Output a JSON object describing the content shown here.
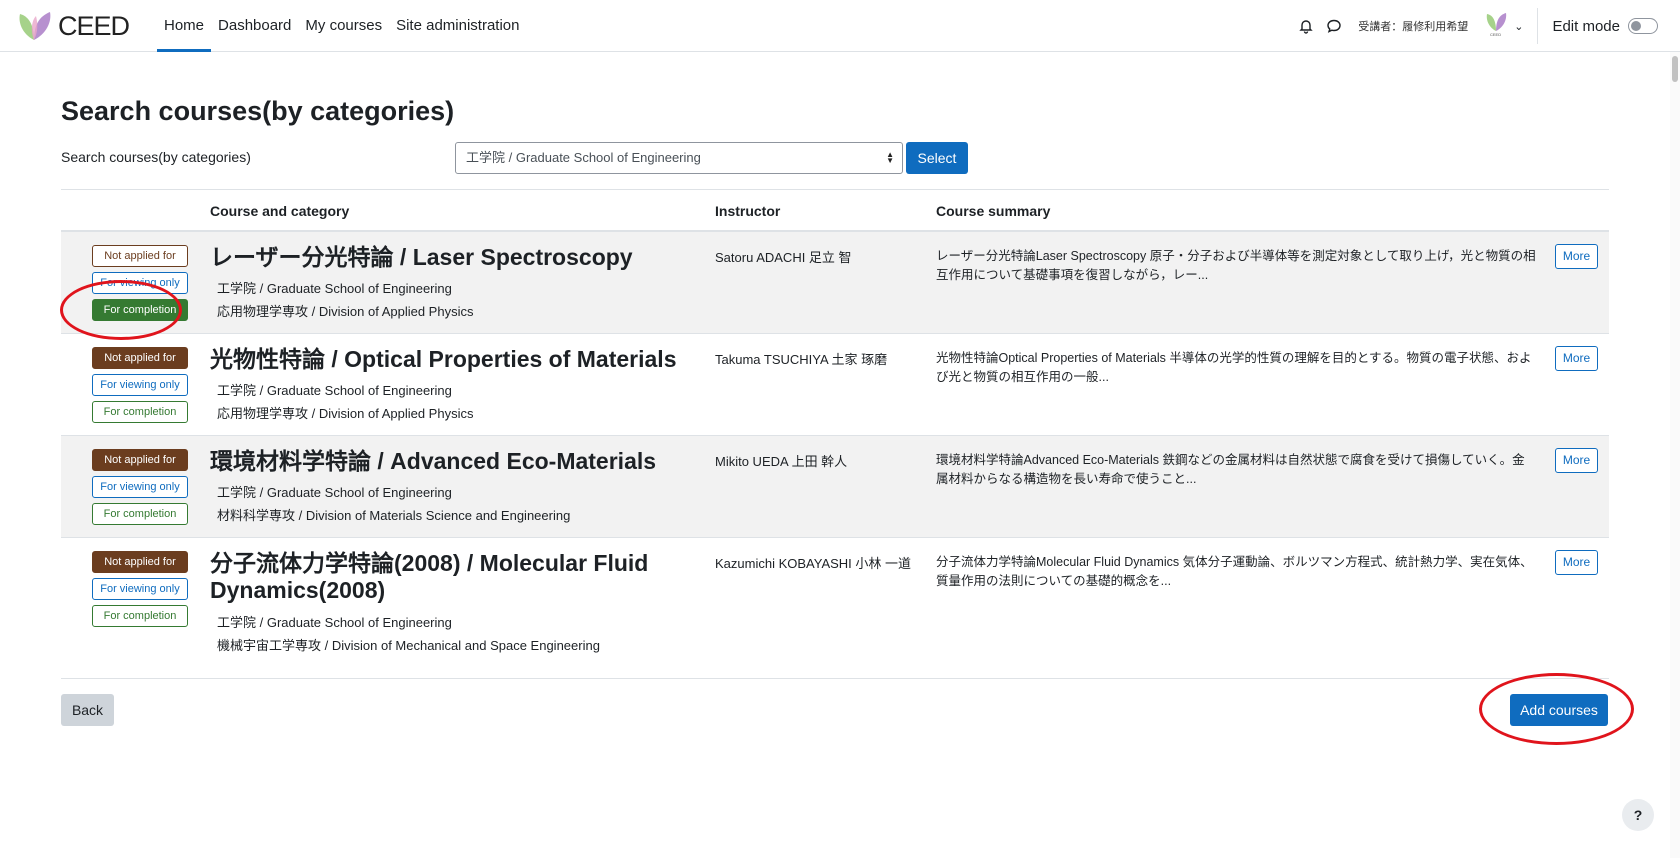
{
  "nav": {
    "logo_text": "CEED",
    "items": [
      "Home",
      "Dashboard",
      "My courses",
      "Site administration"
    ],
    "user_label": "受講者：履修利用希望",
    "avatar_text": "CEED",
    "edit_mode": "Edit mode"
  },
  "page": {
    "title": "Search courses(by categories)",
    "search_label": "Search courses(by categories)",
    "select_value": "工学院 / Graduate School of Engineering",
    "select_button": "Select"
  },
  "table": {
    "headers": {
      "course": "Course and category",
      "instructor": "Instructor",
      "summary": "Course summary"
    },
    "rows": [
      {
        "badges": [
          "Not applied for",
          "For viewing only",
          "For completion"
        ],
        "title": "レーザー分光特論 / Laser Spectroscopy",
        "school": "工学院 / Graduate School of Engineering",
        "division": "応用物理学専攻 / Division of Applied Physics",
        "instructor": "Satoru ADACHI 足立 智",
        "summary": "レーザー分光特論Laser Spectroscopy 原子・分子および半導体等を測定対象として取り上げ，光と物質の相互作用について基礎事項を復習しながら，レー...",
        "more": "More"
      },
      {
        "badges": [
          "Not applied for",
          "For viewing only",
          "For completion"
        ],
        "title": "光物性特論 / Optical Properties of Materials",
        "school": "工学院 / Graduate School of Engineering",
        "division": "応用物理学専攻 / Division of Applied Physics",
        "instructor": "Takuma TSUCHIYA 土家 琢磨",
        "summary": "光物性特論Optical Properties of Materials 半導体の光学的性質の理解を目的とする。物質の電子状態、および光と物質の相互作用の一般...",
        "more": "More"
      },
      {
        "badges": [
          "Not applied for",
          "For viewing only",
          "For completion"
        ],
        "title": "環境材料学特論 / Advanced Eco-Materials",
        "school": "工学院 / Graduate School of Engineering",
        "division": "材料科学専攻 / Division of Materials Science and Engineering",
        "instructor": "Mikito UEDA 上田 幹人",
        "summary": "環境材料学特論Advanced Eco-Materials 鉄鋼などの金属材料は自然状態で腐食を受けて損傷していく。金属材料からなる構造物を長い寿命で使うこと...",
        "more": "More"
      },
      {
        "badges": [
          "Not applied for",
          "For viewing only",
          "For completion"
        ],
        "title": "分子流体力学特論(2008) / Molecular Fluid Dynamics(2008)",
        "school": "工学院 / Graduate School of Engineering",
        "division": "機械宇宙工学専攻 / Division of Mechanical and Space Engineering",
        "instructor": "Kazumichi KOBAYASHI 小林 一道",
        "summary": "分子流体力学特論Molecular Fluid Dynamics 気体分子運動論、ボルツマン方程式、統計熱力学、実在気体、質量作用の法則についての基礎的概念を...",
        "more": "More"
      }
    ]
  },
  "footer": {
    "back": "Back",
    "add": "Add courses",
    "help": "?"
  },
  "colors": {
    "primary": "#0f6cbf",
    "brown": "#6b3d1f",
    "green": "#357a32",
    "annotation": "#e0141c"
  }
}
